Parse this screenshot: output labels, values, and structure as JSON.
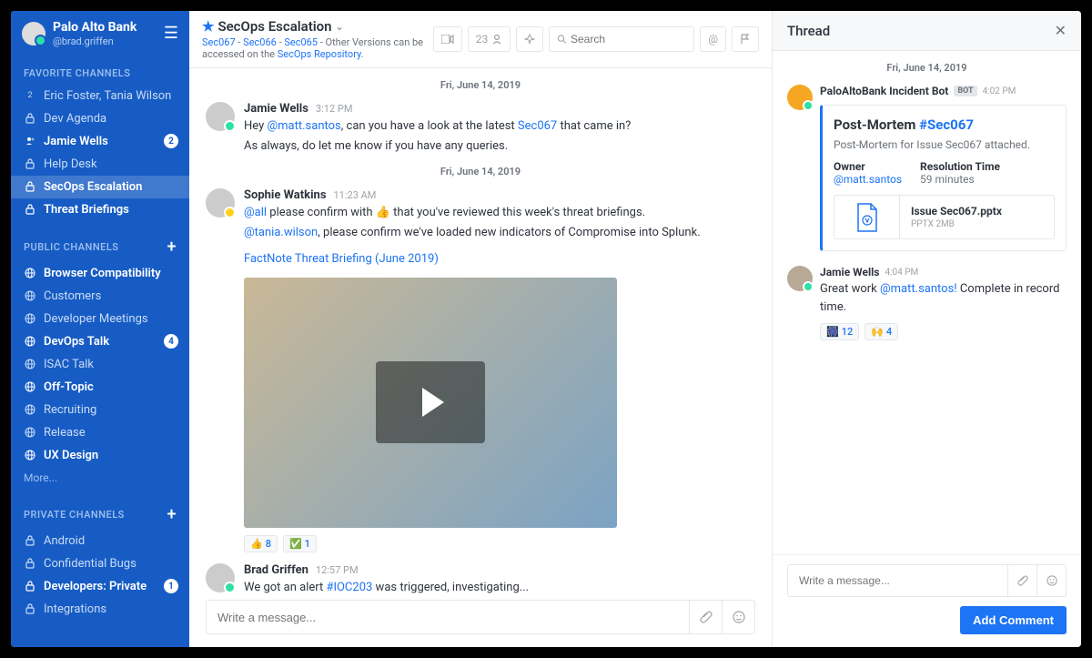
{
  "sidebar": {
    "org": "Palo Alto Bank",
    "handle": "@brad.griffen",
    "sections": {
      "fav": {
        "label": "FAVORITE CHANNELS"
      },
      "pub": {
        "label": "PUBLIC CHANNELS"
      },
      "priv": {
        "label": "PRIVATE CHANNELS"
      }
    },
    "fav_items": [
      {
        "label": "Eric Foster, Tania Wilson",
        "icon": "user-pair"
      },
      {
        "label": "Dev Agenda",
        "icon": "lock"
      },
      {
        "label": "Jamie Wells",
        "icon": "presence",
        "badge": "2",
        "bold": true
      },
      {
        "label": "Help Desk",
        "icon": "lock"
      },
      {
        "label": "SecOps Escalation",
        "icon": "lock",
        "active": true
      },
      {
        "label": "Threat Briefings",
        "icon": "lock",
        "bold": true
      }
    ],
    "pub_items": [
      {
        "label": "Browser Compatibility",
        "bold": true
      },
      {
        "label": "Customers"
      },
      {
        "label": "Developer Meetings"
      },
      {
        "label": "DevOps Talk",
        "badge": "4",
        "bold": true
      },
      {
        "label": "ISAC Talk"
      },
      {
        "label": "Off-Topic",
        "bold": true
      },
      {
        "label": "Recruiting"
      },
      {
        "label": "Release"
      },
      {
        "label": "UX Design",
        "bold": true
      }
    ],
    "more": "More...",
    "priv_items": [
      {
        "label": "Android"
      },
      {
        "label": "Confidential Bugs"
      },
      {
        "label": "Developers: Private",
        "badge": "1",
        "bold": true
      },
      {
        "label": "Integrations"
      }
    ]
  },
  "topbar": {
    "title": "SecOps Escalation",
    "sub_pre": "",
    "links": [
      "Sec067",
      "Sec066",
      "Sec065"
    ],
    "sep": " - ",
    "sub_post": "Other Versions can be accessed on the ",
    "repo": "SecOps Repository",
    "tail": ".",
    "members": "23",
    "search_placeholder": "Search"
  },
  "dates": {
    "d1": "Fri, June 14, 2019",
    "d2": "Fri, June 14, 2019"
  },
  "messages": [
    {
      "name": "Jamie Wells",
      "time": "3:12 PM",
      "lines": [
        [
          {
            "t": "Hey "
          },
          {
            "t": "@matt.santos",
            "cls": "mention"
          },
          {
            "t": ", can you have a look at the latest "
          },
          {
            "t": "Sec067",
            "cls": "link"
          },
          {
            "t": " that came in?"
          }
        ],
        [
          {
            "t": "As always, do let me know if you have any queries."
          }
        ]
      ]
    },
    {
      "name": "Sophie Watkins",
      "time": "11:23 AM",
      "away": true,
      "lines": [
        [
          {
            "t": "@all",
            "cls": "mention"
          },
          {
            "t": " please confirm with 👍 that you've reviewed this week's threat briefings."
          }
        ],
        [
          {
            "t": "@tania.wilson",
            "cls": "mention"
          },
          {
            "t": ", please confirm we've loaded new indicators of Compromise into Splunk."
          }
        ]
      ],
      "attach_link": "FactNote Threat Briefing (June 2019)",
      "video": true,
      "reactions": [
        {
          "e": "👍",
          "c": "8"
        },
        {
          "e": "✅",
          "c": "1"
        }
      ]
    },
    {
      "name": "Brad Griffen",
      "time": "12:57 PM",
      "lines": [
        [
          {
            "t": "We got an alert "
          },
          {
            "t": "#IOC203",
            "cls": "hashtag"
          },
          {
            "t": " was triggered, investigating..."
          }
        ]
      ]
    }
  ],
  "composer": {
    "placeholder": "Write a message..."
  },
  "thread": {
    "title": "Thread",
    "date": "Fri, June 14, 2019",
    "first": {
      "name": "PaloAltoBank Incident Bot",
      "tag": "BOT",
      "time": "4:02 PM",
      "card": {
        "title_pre": "Post-Mortem ",
        "title_tag": "#Sec067",
        "sub": "Post-Mortem for Issue Sec067 attached.",
        "owner_lbl": "Owner",
        "owner_val": "@matt.santos",
        "res_lbl": "Resolution Time",
        "res_val": "59 minutes",
        "file_name": "Issue Sec067.pptx",
        "file_meta": "PPTX 2MB"
      }
    },
    "second": {
      "name": "Jamie Wells",
      "time": "4:04 PM",
      "text_pre": "Great work ",
      "mention": "@matt.santos!",
      "text_post": " Complete in record time.",
      "reactions": [
        {
          "e": "🎆",
          "c": "12"
        },
        {
          "e": "🙌",
          "c": "4"
        }
      ]
    },
    "composer_placeholder": "Write a message...",
    "button": "Add Comment"
  }
}
